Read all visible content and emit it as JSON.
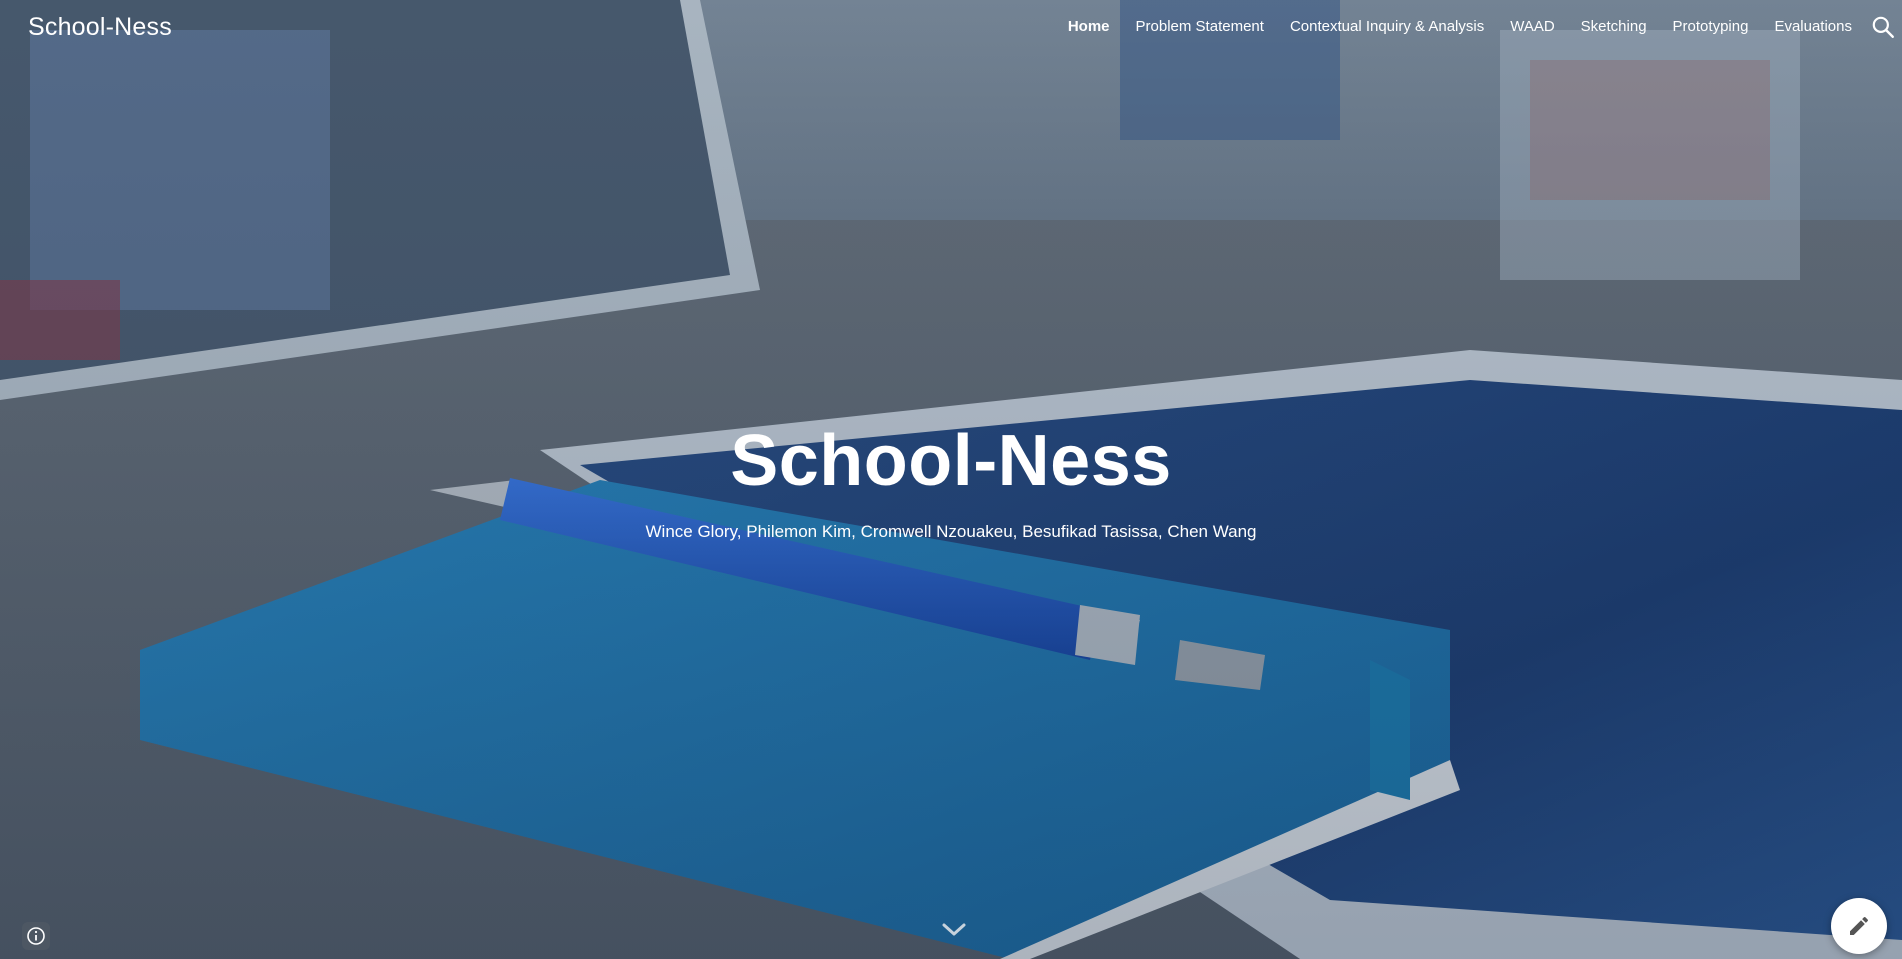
{
  "site": {
    "title": "School-Ness"
  },
  "nav": {
    "items": [
      {
        "label": "Home",
        "active": true
      },
      {
        "label": "Problem Statement",
        "active": false
      },
      {
        "label": "Contextual Inquiry & Analysis",
        "active": false
      },
      {
        "label": "WAAD",
        "active": false
      },
      {
        "label": "Sketching",
        "active": false
      },
      {
        "label": "Prototyping",
        "active": false
      },
      {
        "label": "Evaluations",
        "active": false
      }
    ],
    "search_icon": "search-icon"
  },
  "hero": {
    "title": "School-Ness",
    "subtitle": "Wince Glory, Philemon Kim, Cromwell Nzouakeu, Besufikad Tasissa, Chen Wang",
    "background": "desk with blue notebook, pen, and tablet",
    "scroll_icon": "chevron-down-icon"
  },
  "footer": {
    "info_icon": "info-icon",
    "edit_icon": "pencil-icon"
  },
  "colors": {
    "text": "#ffffff",
    "notebook": "#1f7fb8",
    "pen": "#1d5fc9",
    "fab": "#ffffff"
  }
}
